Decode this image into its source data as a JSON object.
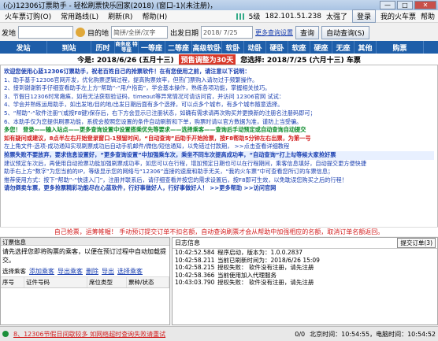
{
  "window": {
    "title": "(心)12306订票助手 - 轻松刷票快乐回家(2018) (窗口-1)(未注册)，按F8注册，[未登录]",
    "min": "—",
    "max": "□",
    "close": "✕"
  },
  "menu": {
    "items": [
      "火车票订购(O)",
      "常用路线(L)",
      "刷新(R)",
      "帮助(H)"
    ],
    "signal": "5级",
    "ip": "182.101.51.238",
    "user": "太强了",
    "login": "登录",
    "myticket": "我的火车票",
    "help": "帮助"
  },
  "toolbar": {
    "from_label": "发地",
    "from_value": "",
    "to_label": "目的地",
    "to_placeholder": "简拼/全拼/汉字",
    "date_label": "出发日期",
    "date_value": "2018/ 7/25",
    "settings_link": "更多查询设置",
    "query": "查询",
    "auto_query": "自动查询(S)"
  },
  "tabs": [
    "发站",
    "到站",
    "历时",
    "商务座\n特等座",
    "一等座",
    "二等座",
    "高级软卧",
    "软卧",
    "动卧",
    "硬卧",
    "软座",
    "硬座",
    "无座",
    "其他",
    "购票"
  ],
  "dateline": {
    "today": "今是: 2018/6/26 (五月十三)",
    "presale": "预售调整为30天",
    "book": "您选择: 2018/7/25 (六月十三) 车票"
  },
  "content": {
    "lines": [
      "欢迎您使用心蓝12306订票助手，祝老百姓自己的抢票软件！在有您使用之前，请注意以下说明：",
      "1、助手基于12306官网开发，优化购票逻辑过程，提高购票效率，但热门票购入请勿过于频繁操作。",
      "2、接到谢谢新手仔细查看助手左上方“帮助”-“用户指南”，学会基本操作，熟练各项功能，掌握相关技巧。",
      "3、节假日12306时常瘫痪，如有无法获取验证码，timeout等异常情况可请访问官，并访问 12306官网 试试：",
      "4、学会并熟练运用助手，如出发地/目的地/出发日期后面有多个选择，可以点多个城市，有多个城市随意选择。",
      "5、“帮助”-“软件注册”(或按F8键)保存后，右下方会显示已注册状态，如确有需求请再次购买并更换新的注册名注册码即可；",
      "6、本助手仅为您提供刷票功能，系统会按照您设置的条件自动刷新和下单，购票时请以官方数据为准，谨防上当受骗。",
      "多您！ 登录——输入站点——更多查询设置中设置搭乘优先等要求——选择乘客——查询后手动预定或自动查询自动提交",
      "如有疑问或建议，8点半左右开始登录窗口-1预留时间，“自动查询”后助手开始抢票，按F8帮助5分钟左右出票，为第一号",
      "左上角文件-选项-成功通知实现刷票成功后自动手机邮件/微信/短信通知，以免错过付款期，  >>点击查看详细教程",
      "抢票失败不要放弃，要求信息设置好，“更多查询设置”中加强乘车次，乘坐不同车次提高成功率，“自动查询”打上勾等候大家抢好票",
      "建议预定车次后，再使用自动抢票功能加强刷票成功率，如您可以在行程，增加预定日期也可以在行程期间，乘客信息填好，自动提交更方便快捷",
      "助手右上方“数字”为您当前的IP，等级显示您的网络与“12306”连接的速度和助手无关，“我的火车票”中可查看您所订的车票信息；",
      "推荐使用方式：按下“帮助”-“快速入门”，注册并联系后，请仔细查看并按您的需求设置后，按F8即可生效，以免耽误您购买之后的行程！",
      "请勿倒卖车票，更多抢票精彩功能尽在心蓝软件，行好事做好人，行好事做好人！  >>更多帮助  >>访问官网"
    ],
    "notice": "自己抢票，运筹帷幄！ 手动预订提交订单不扣名额，自动查询刷票才会从帮助中加强相应的名额，取消订单名额返回。"
  },
  "left": {
    "header": "订票信息",
    "prompt": "请先选择您即将购票的乘客，以便在预订过程中自动加载提交。",
    "tools": [
      "选择乘客",
      "添加乘客",
      "导出乘客",
      "删除",
      "导出",
      "选择乘客"
    ],
    "columns": [
      "序号",
      "证件号码",
      "席位类型",
      "票种/状态"
    ]
  },
  "right": {
    "header": "日志信息",
    "feedback": "提交订单(3)",
    "logs": [
      {
        "time": "10:42:52.584",
        "msg": "程序启动，版本为：1.0.0.2837"
      },
      {
        "time": "10:42:58.211",
        "msg": "当前已刷新时间为：2018/6/26 15:09"
      },
      {
        "time": "10:42:58.215",
        "msg": "授权失败：  软件没有注册，请先注册"
      },
      {
        "time": "10:42:58.366",
        "msg": "当前使用加入代理服务"
      },
      {
        "time": "10:43:03.790",
        "msg": "授权失败：  软件没有注册，请先注册"
      }
    ]
  },
  "status": {
    "alert": "8、12306节假日间歇较多 如网络超时查询失败请重试",
    "counter": "0/0",
    "server": "北京时间：10:54:55，电脑时间：10:54:52"
  }
}
